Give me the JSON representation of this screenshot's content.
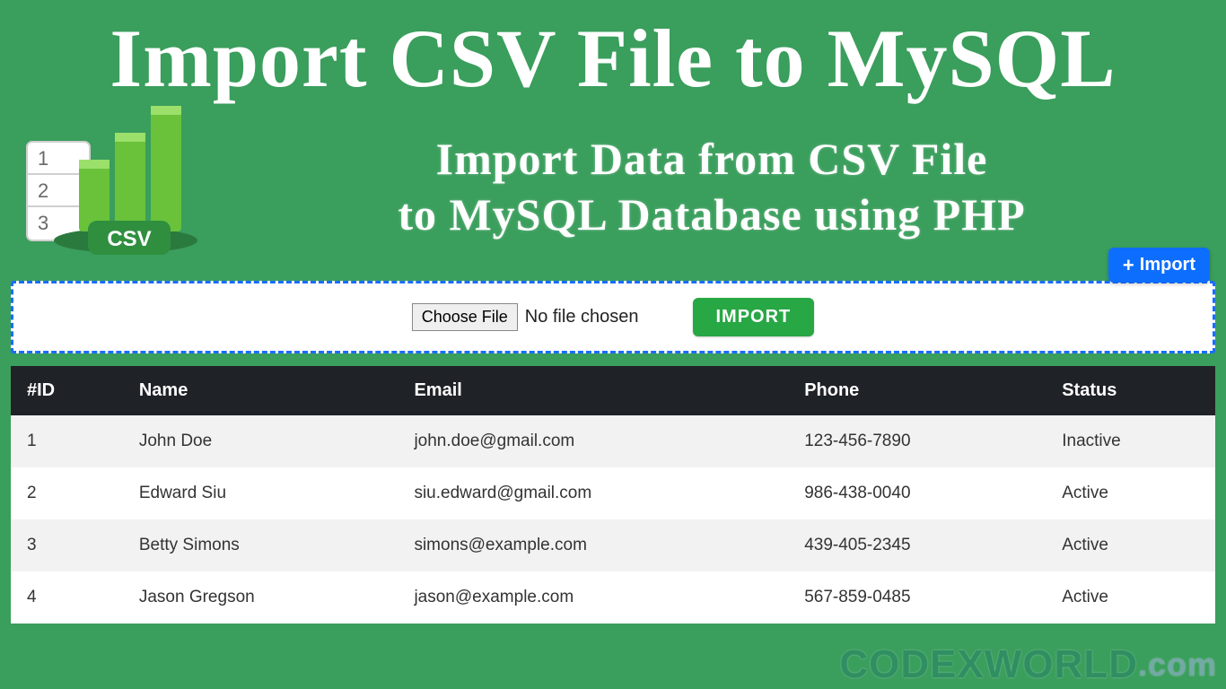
{
  "hero": {
    "title": "Import CSV File to MySQL",
    "subtitle_line1": "Import Data from CSV File",
    "subtitle_line2": "to MySQL Database using PHP",
    "import_button": "Import"
  },
  "uploader": {
    "choose_file_label": "Choose File",
    "file_status": "No file chosen",
    "submit_label": "IMPORT"
  },
  "table": {
    "headers": [
      "#ID",
      "Name",
      "Email",
      "Phone",
      "Status"
    ],
    "rows": [
      {
        "id": "1",
        "name": "John Doe",
        "email": "john.doe@gmail.com",
        "phone": "123-456-7890",
        "status": "Inactive"
      },
      {
        "id": "2",
        "name": "Edward Siu",
        "email": "siu.edward@gmail.com",
        "phone": "986-438-0040",
        "status": "Active"
      },
      {
        "id": "3",
        "name": "Betty Simons",
        "email": "simons@example.com",
        "phone": "439-405-2345",
        "status": "Active"
      },
      {
        "id": "4",
        "name": "Jason Gregson",
        "email": "jason@example.com",
        "phone": "567-859-0485",
        "status": "Active"
      }
    ]
  },
  "watermark": {
    "text": "CODEXWORLD",
    "suffix": ".com"
  },
  "icons": {
    "csv_icon": "csv-chart-icon",
    "plus_icon": "plus-icon"
  },
  "colors": {
    "brand_green": "#3a9e5c",
    "accent_blue": "#0d6efd",
    "accent_green": "#28a745",
    "header_dark": "#1f2226"
  }
}
